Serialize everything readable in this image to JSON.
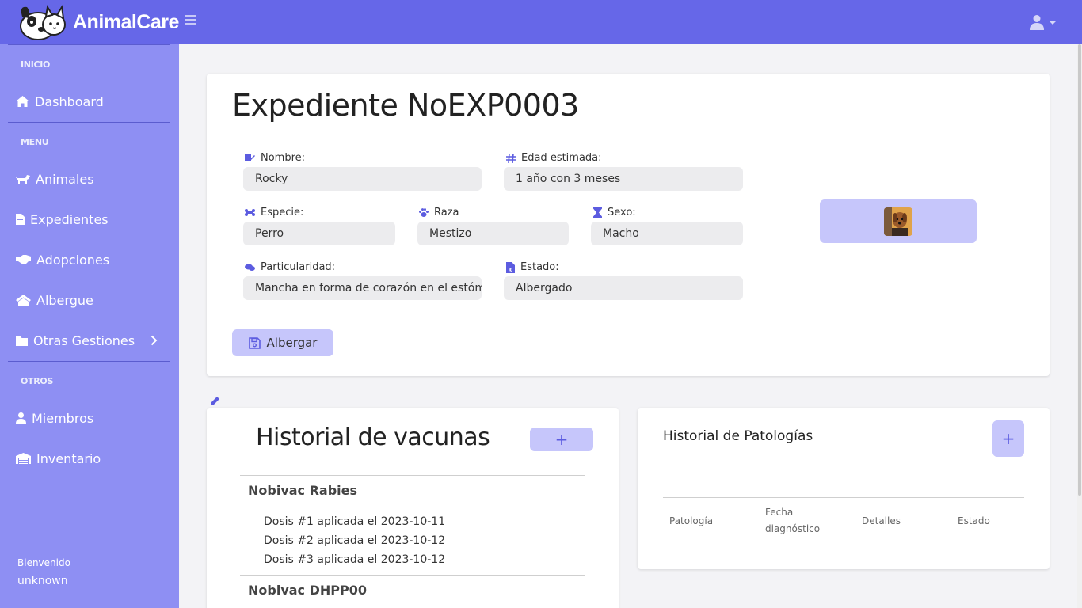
{
  "app": {
    "name": "AnimalCare"
  },
  "sidebar": {
    "sections": {
      "inicio": "INICIO",
      "menu": "MENU",
      "otros": "OTROS"
    },
    "items": {
      "dashboard": "Dashboard",
      "animales": "Animales",
      "expedientes": "Expedientes",
      "adopciones": "Adopciones",
      "albergue": "Albergue",
      "otras": "Otras Gestiones",
      "miembros": "Miembros",
      "inventario": "Inventario"
    },
    "welcome": "Bienvenido",
    "username": "unknown"
  },
  "expediente": {
    "title": "Expediente NoEXP0003",
    "labels": {
      "nombre": "Nombre:",
      "edad": "Edad estimada:",
      "especie": "Especie:",
      "raza": "Raza",
      "sexo": "Sexo:",
      "particularidad": "Particularidad:",
      "estado": "Estado:"
    },
    "values": {
      "nombre": "Rocky",
      "edad": "1 año con 3 meses",
      "especie": "Perro",
      "raza": "Mestizo",
      "sexo": "Macho",
      "particularidad": "Mancha en forma de corazón en el estómago",
      "estado": "Albergado"
    },
    "button": "Albergar"
  },
  "vacunas": {
    "title": "Historial de vacunas",
    "add_symbol": "+",
    "items": [
      {
        "name": "Nobivac Rabies",
        "doses": [
          "Dosis #1 aplicada el 2023-10-11",
          "Dosis #2 aplicada el 2023-10-12",
          "Dosis #3 aplicada el 2023-10-12"
        ]
      },
      {
        "name": "Nobivac DHPP00"
      }
    ]
  },
  "patologias": {
    "title": "Historial de Patologías",
    "add_symbol": "+",
    "columns": [
      "Patología",
      "Fecha",
      "diagnóstico",
      "Detalles",
      "Estado"
    ]
  },
  "colors": {
    "topbar": "#6667e8",
    "sidebar": "#8e8ff3",
    "accent_light": "#c6c6fb",
    "icon": "#5c5ce0"
  }
}
